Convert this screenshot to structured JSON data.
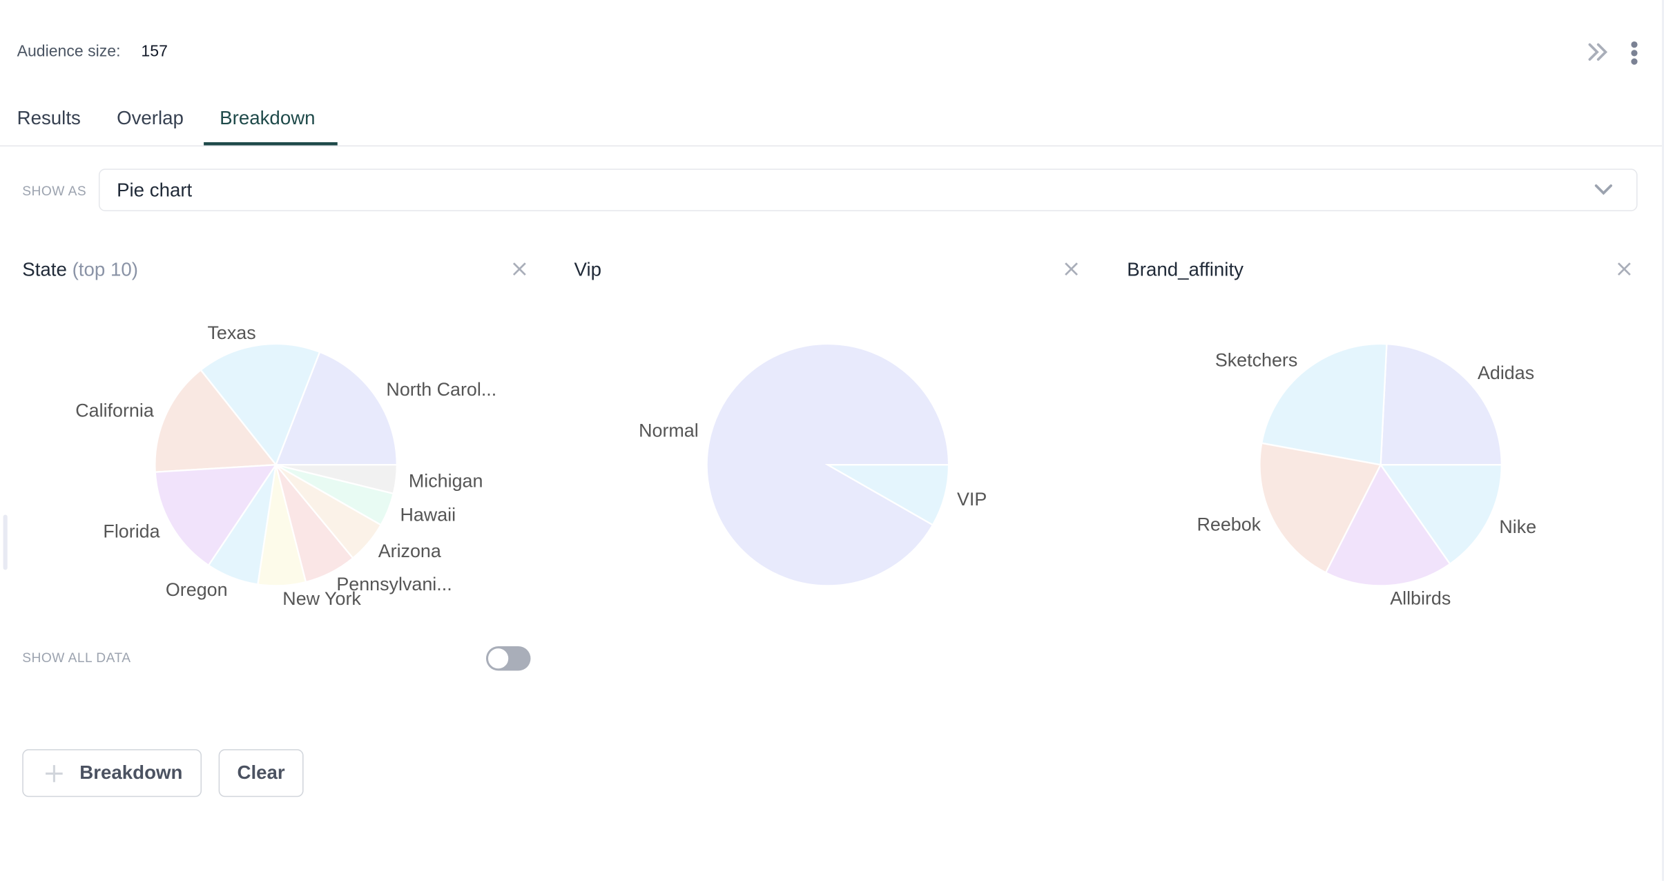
{
  "header": {
    "audience_label": "Audience size:",
    "audience_value": "157"
  },
  "tabs": [
    {
      "label": "Results"
    },
    {
      "label": "Overlap"
    },
    {
      "label": "Breakdown",
      "active": true
    }
  ],
  "controls": {
    "show_as_label": "SHOW AS",
    "show_as_value": "Pie chart",
    "show_all_data_label": "SHOW ALL DATA",
    "show_all_data_on": false
  },
  "buttons": {
    "breakdown": "Breakdown",
    "clear": "Clear"
  },
  "panels": [
    {
      "title": "State",
      "subtitle": "(top 10)"
    },
    {
      "title": "Vip",
      "subtitle": ""
    },
    {
      "title": "Brand_affinity",
      "subtitle": ""
    }
  ],
  "chart_data": [
    {
      "type": "pie",
      "categories": [
        "North Carol...",
        "Texas",
        "California",
        "Florida",
        "Oregon",
        "New York",
        "Pennsylvani...",
        "Arizona",
        "Hawaii",
        "Michigan"
      ],
      "values": [
        30,
        26,
        24,
        23,
        11,
        10,
        11,
        9,
        7,
        6
      ],
      "colors": [
        "#e8eafc",
        "#e4f5fd",
        "#f9e8e2",
        "#f1e3fb",
        "#e4f5fd",
        "#fdfbea",
        "#fae6e6",
        "#fbf2e8",
        "#e8fbf3",
        "#f1f1f1"
      ]
    },
    {
      "type": "pie",
      "categories": [
        "Normal",
        "VIP"
      ],
      "values": [
        144,
        13
      ],
      "colors": [
        "#e8eafc",
        "#e4f5fd"
      ]
    },
    {
      "type": "pie",
      "categories": [
        "Adidas",
        "Sketchers",
        "Reebok",
        "Allbirds",
        "Nike"
      ],
      "values": [
        38,
        36,
        32,
        27,
        24
      ],
      "colors": [
        "#e8eafc",
        "#e4f5fd",
        "#f9e8e2",
        "#f1e3fb",
        "#e4f5fd"
      ]
    }
  ],
  "colors": {
    "accent": "#1f4a4a",
    "icon": "#a9aeb9"
  }
}
